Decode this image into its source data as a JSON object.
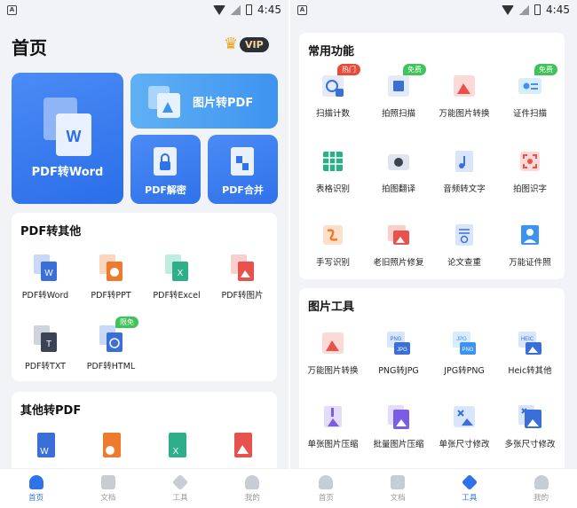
{
  "status": {
    "time": "4:45"
  },
  "left": {
    "title": "首页",
    "vip_label": "VIP",
    "hero": {
      "pdf_to_word": "PDF转Word",
      "image_to_pdf": "图片转PDF",
      "pdf_decrypt": "PDF解密",
      "pdf_merge": "PDF合并"
    },
    "pdf_to_other": {
      "title": "PDF转其他",
      "items": [
        {
          "label": "PDF转Word",
          "icon": "pdf-to-word-icon",
          "color": "#3b6fd8"
        },
        {
          "label": "PDF转PPT",
          "icon": "pdf-to-ppt-icon",
          "color": "#ee7a2e"
        },
        {
          "label": "PDF转Excel",
          "icon": "pdf-to-excel-icon",
          "color": "#2fae8a"
        },
        {
          "label": "PDF转图片",
          "icon": "pdf-to-image-icon",
          "color": "#e8524c"
        },
        {
          "label": "PDF转TXT",
          "icon": "pdf-to-txt-icon",
          "color": "#3b4455"
        },
        {
          "label": "PDF转HTML",
          "icon": "pdf-to-html-icon",
          "color": "#3b6fd8",
          "badge": "限免"
        }
      ]
    },
    "other_to_pdf": {
      "title": "其他转PDF"
    },
    "nav": [
      "首页",
      "文档",
      "工具",
      "我的"
    ]
  },
  "right": {
    "common": {
      "title": "常用功能",
      "items": [
        {
          "label": "扫描计数",
          "badge": "热门"
        },
        {
          "label": "拍照扫描",
          "badge": "免费"
        },
        {
          "label": "万能图片转换"
        },
        {
          "label": "证件扫描",
          "badge": "免费"
        },
        {
          "label": "表格识别"
        },
        {
          "label": "拍图翻译"
        },
        {
          "label": "音频转文字"
        },
        {
          "label": "拍图识字"
        },
        {
          "label": "手写识别"
        },
        {
          "label": "老旧照片修复"
        },
        {
          "label": "论文查重"
        },
        {
          "label": "万能证件照"
        }
      ]
    },
    "image_tools": {
      "title": "图片工具",
      "items": [
        {
          "label": "万能图片转换"
        },
        {
          "label": "PNG转JPG"
        },
        {
          "label": "JPG转PNG"
        },
        {
          "label": "Heic转其他"
        },
        {
          "label": "单张图片压缩"
        },
        {
          "label": "批量图片压缩"
        },
        {
          "label": "单张尺寸修改"
        },
        {
          "label": "多张尺寸修改"
        }
      ]
    },
    "nav": [
      "首页",
      "文档",
      "工具",
      "我的"
    ]
  },
  "colors": {
    "accent": "#2f72ea",
    "green_badge": "#3ec45a",
    "red_badge": "#e94a3a"
  }
}
